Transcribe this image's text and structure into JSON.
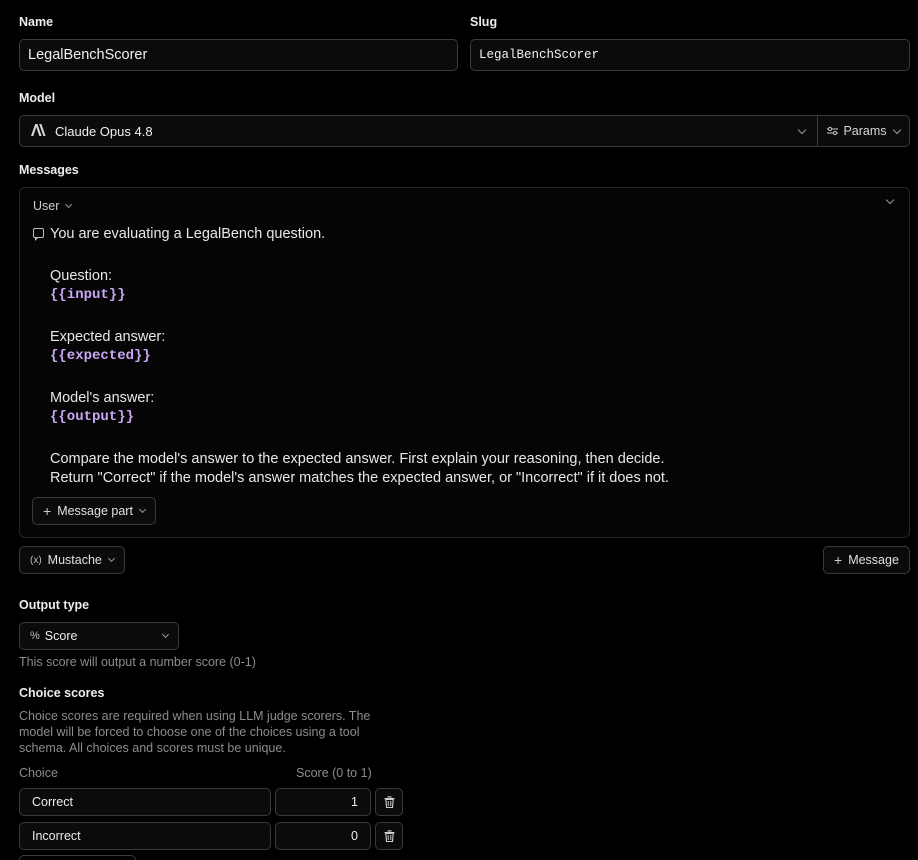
{
  "name": {
    "label": "Name",
    "value": "LegalBenchScorer"
  },
  "slug": {
    "label": "Slug",
    "value": "LegalBenchScorer"
  },
  "model": {
    "label": "Model",
    "selected": "Claude Opus 4.8",
    "params_label": "Params",
    "brand_icon": "anthropic-icon"
  },
  "messages": {
    "label": "Messages",
    "role": "User",
    "lines": [
      "You are evaluating a LegalBench question.",
      "",
      "Question:",
      "{{input}}",
      "",
      "Expected answer:",
      "{{expected}}",
      "",
      "Model's answer:",
      "{{output}}",
      "",
      "Compare the model's answer to the expected answer. First explain your reasoning, then decide.",
      "Return \"Correct\" if the model's answer matches the expected answer, or \"Incorrect\" if it does not."
    ],
    "add_part_label": "Message part",
    "add_message_label": "Message"
  },
  "template_format": {
    "selected": "Mustache"
  },
  "output_type": {
    "label": "Output type",
    "selected": "Score",
    "helper": "This score will output a number score (0-1)"
  },
  "choice_scores": {
    "label": "Choice scores",
    "helper": "Choice scores are required when using LLM judge scorers. The model will be forced to choose one of the choices using a tool schema. All choices and scores must be unique.",
    "columns": {
      "choice": "Choice",
      "score": "Score (0 to 1)"
    },
    "rows": [
      {
        "choice": "Correct",
        "score": "1"
      },
      {
        "choice": "Incorrect",
        "score": "0"
      }
    ]
  },
  "colors": {
    "background": "#000000",
    "border": "#3a3a3a",
    "variable": "#c9a7f5",
    "muted": "#8c8c8c"
  }
}
